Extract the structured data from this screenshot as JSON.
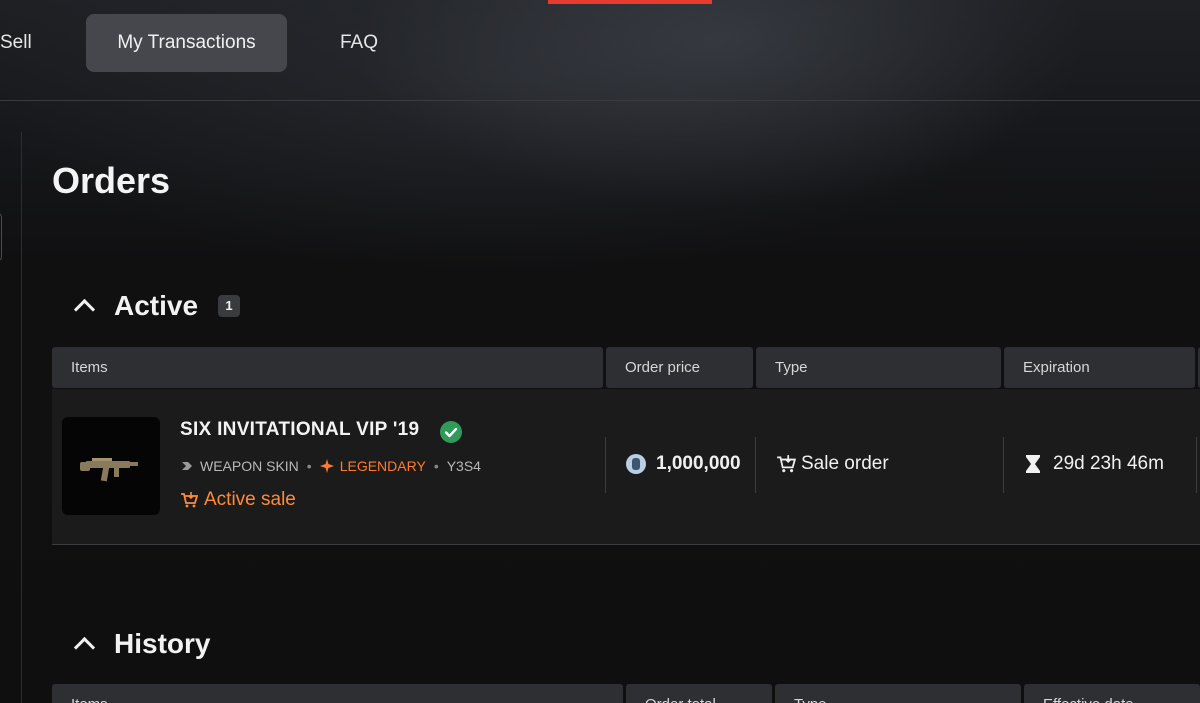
{
  "nav": {
    "sell": "Sell",
    "transactions": "My Transactions",
    "faq": "FAQ"
  },
  "page": {
    "title": "Orders"
  },
  "active": {
    "title": "Active",
    "count": "1",
    "columns": [
      "Items",
      "Order price",
      "Type",
      "Expiration"
    ],
    "rows": [
      {
        "name": "SIX INVITATIONAL VIP '19",
        "category": "WEAPON SKIN",
        "rarity": "LEGENDARY",
        "season": "Y3S4",
        "status": "Active sale",
        "price": "1,000,000",
        "type": "Sale order",
        "expiration": "29d 23h 46m"
      }
    ]
  },
  "history": {
    "title": "History",
    "columns": [
      "Items",
      "Order total",
      "Type",
      "Effective date"
    ]
  },
  "colors": {
    "accent_red": "#e63b2e",
    "legendary_orange": "#ff7a2e",
    "verified_green": "#2f9a5a"
  }
}
